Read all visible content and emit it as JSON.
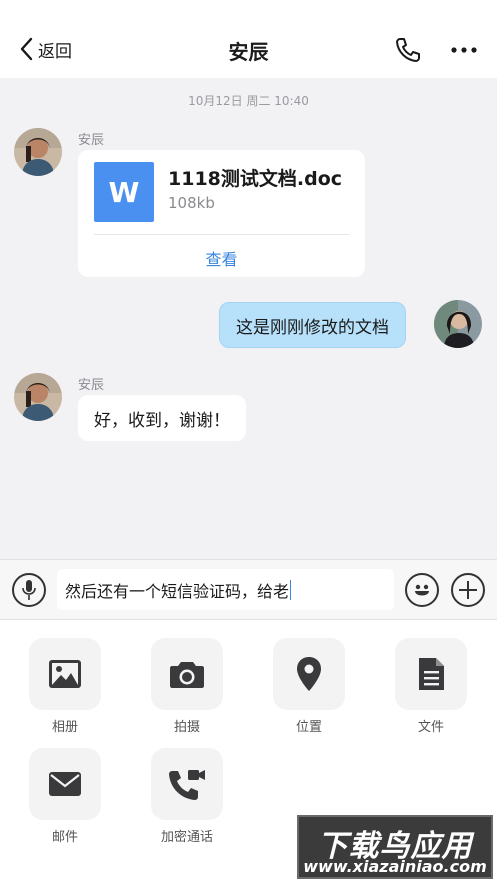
{
  "header": {
    "back_label": "返回",
    "title": "安辰",
    "call_icon": "phone-icon",
    "more_icon": "more-icon"
  },
  "chat": {
    "timestamp": "10月12日 周二 10:40",
    "messages": [
      {
        "side": "left",
        "sender": "安辰",
        "type": "file",
        "file_icon_letter": "W",
        "file_name": "1118测试文档.doc",
        "file_size": "108kb",
        "action": "查看"
      },
      {
        "side": "right",
        "type": "text",
        "text": "这是刚刚修改的文档"
      },
      {
        "side": "left",
        "sender": "安辰",
        "type": "text",
        "text": "好，收到，谢谢！"
      }
    ]
  },
  "input": {
    "value": "然后还有一个短信验证码，给老",
    "voice_icon": "microphone-icon",
    "emoji_icon": "emoji-icon",
    "plus_icon": "plus-icon"
  },
  "panel": {
    "actions": [
      {
        "label": "相册",
        "icon": "image-icon"
      },
      {
        "label": "拍摄",
        "icon": "camera-icon"
      },
      {
        "label": "位置",
        "icon": "location-pin-icon"
      },
      {
        "label": "文件",
        "icon": "file-icon"
      },
      {
        "label": "邮件",
        "icon": "mail-icon"
      },
      {
        "label": "加密通话",
        "icon": "video-call-icon"
      }
    ]
  },
  "watermark": {
    "title": "下载鸟应用",
    "url": "www.xiazainiao.com"
  },
  "colors": {
    "accent": "#3a86e0",
    "outgoing_bubble": "#b7e0fa",
    "file_icon_bg": "#4a90f0",
    "background": "#f2f2f4"
  }
}
